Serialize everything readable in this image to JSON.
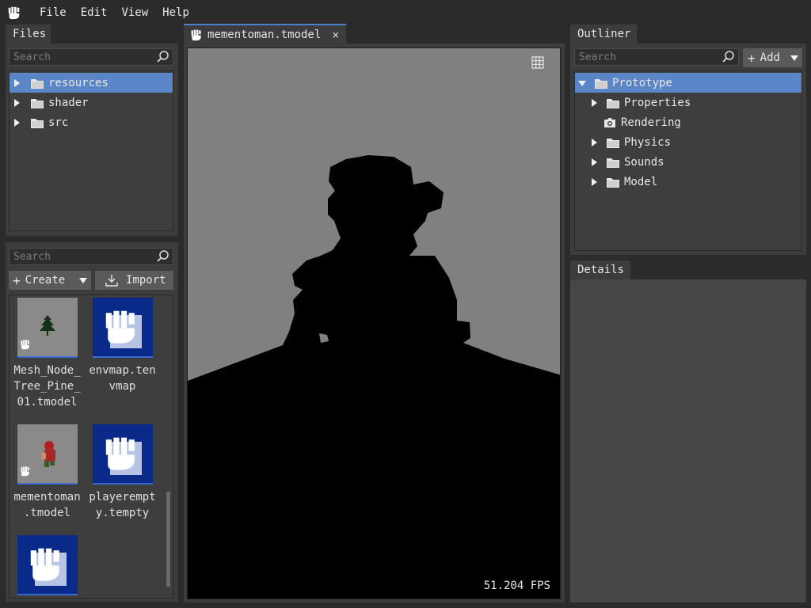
{
  "menubar": {
    "items": [
      "File",
      "Edit",
      "View",
      "Help"
    ]
  },
  "files_panel": {
    "tab": "Files",
    "search_placeholder": "Search",
    "tree": [
      {
        "label": "resources",
        "selected": true
      },
      {
        "label": "shader",
        "selected": false
      },
      {
        "label": "src",
        "selected": false
      }
    ]
  },
  "assets_panel": {
    "search_placeholder": "Search",
    "create_label": "Create",
    "import_label": "Import",
    "items": [
      {
        "label": "Mesh_Node_Tree_Pine_01.tmodel",
        "lines": [
          "Mesh_Node_",
          "Tree_Pine_",
          "01.tmodel"
        ],
        "thumb": "tree-thumbnail"
      },
      {
        "label": "envmap.tenvmap",
        "lines": [
          "envmap.ten",
          "vmap"
        ],
        "thumb": "app-logo-thumbnail"
      },
      {
        "label": "mementoman.tmodel",
        "lines": [
          "mementoman",
          ".tmodel"
        ],
        "thumb": "character-thumbnail"
      },
      {
        "label": "playerempty.tempty",
        "lines": [
          "playerempt",
          "y.tempty"
        ],
        "thumb": "app-logo-thumbnail"
      },
      {
        "label": "",
        "lines": [],
        "thumb": "app-logo-thumbnail"
      }
    ]
  },
  "viewport": {
    "tab_label": "mementoman.tmodel",
    "fps": "51.204 FPS",
    "colors": {
      "background": "#808080",
      "silhouette": "#000000"
    }
  },
  "outliner": {
    "tab": "Outliner",
    "search_placeholder": "Search",
    "add_label": "Add",
    "tree": [
      {
        "label": "Prototype",
        "expanded": true,
        "selected": true,
        "icon": "folder-icon"
      },
      {
        "label": "Properties",
        "icon": "folder-icon"
      },
      {
        "label": "Rendering",
        "icon": "camera-icon"
      },
      {
        "label": "Physics",
        "icon": "folder-icon"
      },
      {
        "label": "Sounds",
        "icon": "folder-icon"
      },
      {
        "label": "Model",
        "icon": "folder-icon"
      }
    ]
  },
  "details": {
    "tab": "Details"
  },
  "theme": {
    "accent": "#5a86c8",
    "thumb_blue": "#0a2a8a"
  }
}
